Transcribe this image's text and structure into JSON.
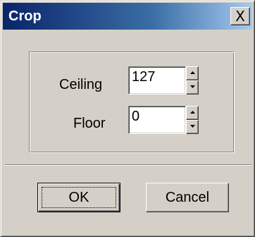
{
  "dialog": {
    "title": "Crop",
    "close_glyph": "X"
  },
  "fields": {
    "ceiling": {
      "label": "Ceiling",
      "value": "127"
    },
    "floor": {
      "label": "Floor",
      "value": "0"
    }
  },
  "buttons": {
    "ok_label": "OK",
    "cancel_label": "Cancel"
  },
  "icons": {
    "close": "close-icon",
    "spin_up": "triangle-up-icon",
    "spin_down": "triangle-down-icon"
  },
  "colors": {
    "titlebar_start": "#0a246a",
    "titlebar_end": "#a6caf0",
    "face": "#d4d0c8"
  }
}
